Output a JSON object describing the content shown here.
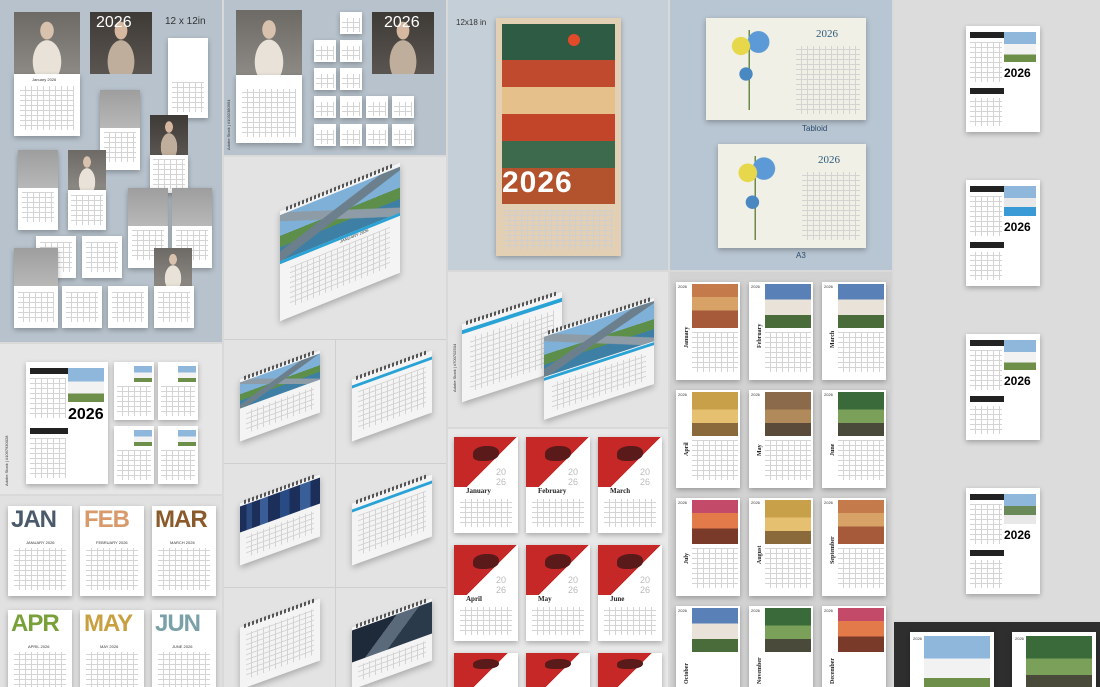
{
  "tiles": {
    "a": {
      "size_label": "12 x 12in",
      "year": "2026",
      "month_caption": "January 2026"
    },
    "b": {
      "year": "2026",
      "watermark": "Adobe Stock | #1032380994"
    },
    "c": {
      "size_label": "12x18 in",
      "year": "2026"
    },
    "d": {
      "year_top": "2026",
      "year_bottom": "2026",
      "caption_top": "Tabloid",
      "caption_bottom": "A3"
    },
    "e": {
      "year": "2026"
    },
    "f": {
      "caption": "JANUARY 2026"
    },
    "g": {
      "year": "2026",
      "watermark": "Adobe Stock | #1097930028"
    },
    "h": {
      "watermark": "Adobe Stock | #700702504"
    },
    "i": {
      "year_top": "20",
      "year_bottom": "26",
      "months": [
        "January",
        "February",
        "March",
        "April",
        "May",
        "June"
      ]
    },
    "j": {
      "year": "2026",
      "months": [
        "January",
        "February",
        "March",
        "April",
        "May",
        "June",
        "July",
        "August",
        "September",
        "October",
        "November",
        "December"
      ]
    },
    "k": {
      "month_titles": [
        "JAN",
        "FEB",
        "MAR",
        "APR",
        "MAY",
        "JUN"
      ],
      "month_captions": [
        "JANUARY 2026",
        "FEBRUARY 2026",
        "MARCH 2026",
        "APRIL 2026",
        "MAY 2026",
        "JUNE 2026"
      ]
    },
    "l": {
      "year": "2026"
    }
  }
}
